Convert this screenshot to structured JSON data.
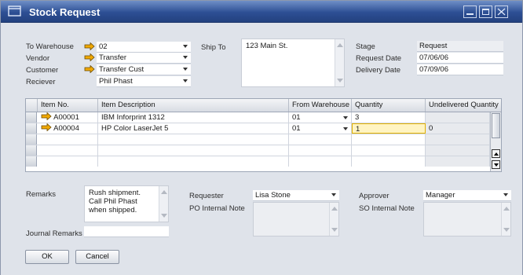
{
  "window": {
    "title": "Stock Request"
  },
  "header": {
    "to_warehouse": {
      "label": "To Warehouse",
      "value": "02"
    },
    "vendor": {
      "label": "Vendor",
      "value": "Transfer"
    },
    "customer": {
      "label": "Customer",
      "value": "Transfer Cust"
    },
    "receiver": {
      "label": "Reciever",
      "value": "Phil Phast"
    },
    "ship_to": {
      "label": "Ship To",
      "value": "123 Main St."
    },
    "stage": {
      "label": "Stage",
      "value": "Request"
    },
    "request_date": {
      "label": "Request Date",
      "value": "07/06/06"
    },
    "delivery_date": {
      "label": "Delivery Date",
      "value": "07/09/06"
    }
  },
  "grid": {
    "columns": [
      "Item No.",
      "Item Description",
      "From Warehouse",
      "Quantity",
      "Undelivered Quantity"
    ],
    "rows": [
      {
        "item_no": "A00001",
        "description": "IBM Inforprint 1312",
        "from_warehouse": "01",
        "quantity": "3",
        "undelivered": ""
      },
      {
        "item_no": "A00004",
        "description": "HP Color LaserJet 5",
        "from_warehouse": "01",
        "quantity": "1",
        "undelivered": "0"
      }
    ]
  },
  "footer": {
    "remarks": {
      "label": "Remarks",
      "value": "Rush shipment. Call Phil Phast when shipped."
    },
    "journal_remarks": {
      "label": "Journal Remarks",
      "value": ""
    },
    "requester": {
      "label": "Requester",
      "value": "Lisa Stone"
    },
    "po_internal_note": {
      "label": "PO Internal Note",
      "value": ""
    },
    "approver": {
      "label": "Approver",
      "value": "Manager"
    },
    "so_internal_note": {
      "label": "SO Internal Note",
      "value": ""
    }
  },
  "buttons": {
    "ok": "OK",
    "cancel": "Cancel"
  },
  "colors": {
    "title_bar": "#2d4f94",
    "link_arrow": "#f0a800",
    "active_cell": "#fff4c2"
  },
  "icons": [
    "window-icon",
    "minimize-icon",
    "maximize-icon",
    "close-icon",
    "link-arrow-icon",
    "dropdown-caret-icon"
  ]
}
